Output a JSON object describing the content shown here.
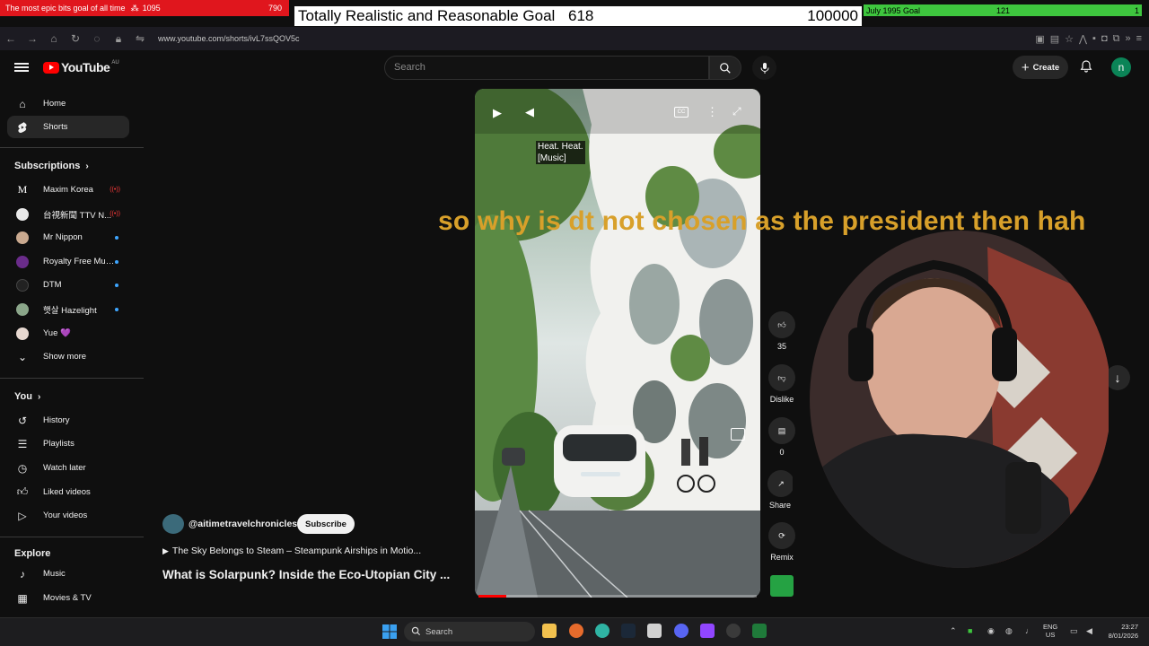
{
  "overlay": {
    "left_goal_text": "The most epic bits goal of all time",
    "left_goal_count": "1095",
    "left_goal_current": "790",
    "mid_goal_title": "Totally Realistic and Reasonable Goal",
    "mid_goal_count": "618",
    "mid_goal_target": "100000",
    "right_goal_title": "July 1995 Goal",
    "right_goal_count": "121",
    "right_goal_target": "1"
  },
  "browser": {
    "url": "www.youtube.com/shorts/ivL7ssQOV5c"
  },
  "header": {
    "logo_text": "YouTube",
    "country_code": "AU",
    "search_placeholder": "Search",
    "create_label": "Create",
    "avatar_letter": "n"
  },
  "sidebar": {
    "main": [
      {
        "label": "Home",
        "icon": "home-icon"
      },
      {
        "label": "Shorts",
        "icon": "shorts-icon"
      }
    ],
    "subscriptions_title": "Subscriptions",
    "subscriptions": [
      {
        "label": "Maxim Korea",
        "status": "live"
      },
      {
        "label": "台視新聞 TTV N...",
        "status": "live"
      },
      {
        "label": "Mr Nippon",
        "status": "new"
      },
      {
        "label": "Royalty Free Mus...",
        "status": "new"
      },
      {
        "label": "DTM",
        "status": "new"
      },
      {
        "label": "햇살 Hazelight",
        "status": "new"
      },
      {
        "label": "Yue 💜",
        "status": ""
      }
    ],
    "show_more": "Show more",
    "you_title": "You",
    "you": [
      {
        "label": "History",
        "icon": "history-icon"
      },
      {
        "label": "Playlists",
        "icon": "playlists-icon"
      },
      {
        "label": "Watch later",
        "icon": "watch-later-icon"
      },
      {
        "label": "Liked videos",
        "icon": "liked-videos-icon"
      },
      {
        "label": "Your videos",
        "icon": "your-videos-icon"
      }
    ],
    "explore_title": "Explore",
    "explore": [
      {
        "label": "Music",
        "icon": "music-icon"
      },
      {
        "label": "Movies & TV",
        "icon": "movies-icon"
      }
    ]
  },
  "video": {
    "caption_line1": "Heat. Heat.",
    "caption_line2": "[Music]",
    "overlay_subtitle": "so why is dt not chosen as the president then hah",
    "channel": "@aitimetravelchronicles",
    "subscribe_label": "Subscribe",
    "related_video": "The Sky Belongs to Steam – Steampunk Airships in Motio...",
    "title": "What is Solarpunk? Inside the Eco-Utopian City ...",
    "progress": 0.1
  },
  "actions": {
    "like_count": "35",
    "dislike_label": "Dislike",
    "comment_count": "0",
    "share_label": "Share",
    "remix_label": "Remix"
  },
  "taskbar": {
    "search_label": "Search",
    "lang_line1": "ENG",
    "lang_line2": "US",
    "time": "23:27",
    "date": "8/01/2026"
  }
}
